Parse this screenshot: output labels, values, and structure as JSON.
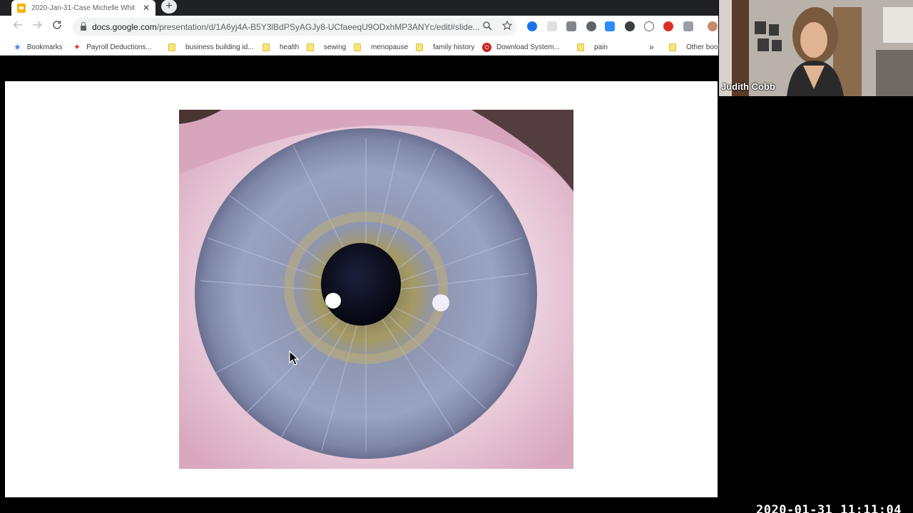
{
  "browser": {
    "tab": {
      "title": "2020-Jan-31-Case Michelle Whit",
      "close_glyph": "✕"
    },
    "new_tab_glyph": "+",
    "url": {
      "host": "docs.google.com",
      "path": "/presentation/d/1A6yj4A-B5Y3lBdPSyAGJy8-UCfaeeqU9ODxhMP3ANYc/edit#slide..."
    },
    "nav_icons": [
      "back-arrow-icon",
      "forward-arrow-icon",
      "reload-icon"
    ],
    "bookmarks": [
      {
        "label": "Bookmarks",
        "icon": "star-icon"
      },
      {
        "label": "Payroll Deductions...",
        "icon": "maple-leaf-icon"
      },
      {
        "label": "business building id...",
        "icon": "folder-icon"
      },
      {
        "label": "health",
        "icon": "folder-icon"
      },
      {
        "label": "sewing",
        "icon": "folder-icon"
      },
      {
        "label": "menopause",
        "icon": "folder-icon"
      },
      {
        "label": "family history",
        "icon": "folder-icon"
      },
      {
        "label": "Download System...",
        "icon": "power-icon"
      },
      {
        "label": "pain",
        "icon": "folder-icon"
      }
    ],
    "overflow_glyph": "»",
    "other_bookmarks": "Other book"
  },
  "video": {
    "participant_name": "Judith Cobb"
  },
  "recording": {
    "timestamp": "2020-01-31 11:11:04"
  },
  "colors": {
    "accent_blue": "#4285f4",
    "slides_yellow": "#f4b400",
    "folder_yellow": "#f9e577"
  }
}
